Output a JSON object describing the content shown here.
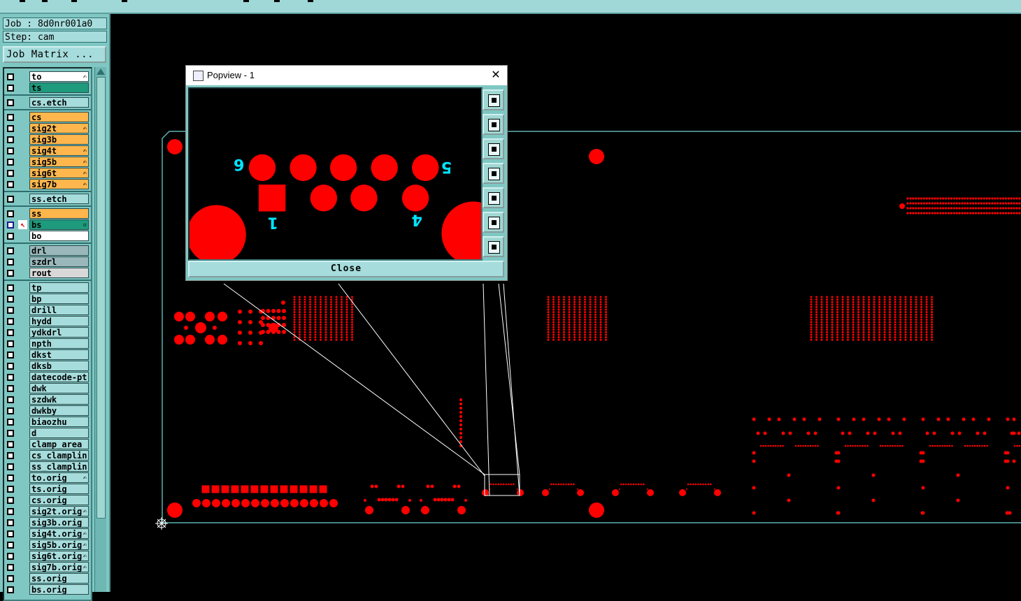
{
  "job": {
    "label": "Job : 8d0nr001a0",
    "step": "Step: cam",
    "matrix_button": "Job Matrix ..."
  },
  "colors": {
    "accent": "#7fc7c3",
    "pad": "#ff0000",
    "label_cyan": "#00e5ff",
    "outline": "#5fb0b0"
  },
  "layers": [
    {
      "name": "to",
      "color": "#ffffff",
      "hand": true
    },
    {
      "name": "ts",
      "color": "#1e9a7c",
      "hand": false
    },
    {
      "name": "cs.etch",
      "color": "#a6dcdc",
      "hand": false
    },
    {
      "name": "cs",
      "color": "#ffb74d",
      "hand": false
    },
    {
      "name": "sig2t",
      "color": "#ffb74d",
      "hand": true
    },
    {
      "name": "sig3b",
      "color": "#ffb74d",
      "hand": false
    },
    {
      "name": "sig4t",
      "color": "#ffb74d",
      "hand": true
    },
    {
      "name": "sig5b",
      "color": "#ffb74d",
      "hand": true
    },
    {
      "name": "sig6t",
      "color": "#ffb74d",
      "hand": true
    },
    {
      "name": "sig7b",
      "color": "#ffb74d",
      "hand": true
    },
    {
      "name": "ss.etch",
      "color": "#a6dcdc",
      "hand": false
    },
    {
      "name": "ss",
      "color": "#ffb74d",
      "hand": false
    },
    {
      "name": "bs",
      "color": "#1e9a7c",
      "hand": false,
      "selected": true
    },
    {
      "name": "bo",
      "color": "#ffffff",
      "hand": false
    },
    {
      "name": "drl",
      "color": "#9ab8bb",
      "hand": false
    },
    {
      "name": "szdrl",
      "color": "#9ab8bb",
      "hand": false
    },
    {
      "name": "rout",
      "color": "#d8d8d8",
      "hand": false
    },
    {
      "name": "tp",
      "color": "#a6dcdc",
      "hand": false
    },
    {
      "name": "bp",
      "color": "#a6dcdc",
      "hand": false
    },
    {
      "name": "drill",
      "color": "#a6dcdc",
      "hand": false
    },
    {
      "name": "hydd",
      "color": "#a6dcdc",
      "hand": false
    },
    {
      "name": "ydkdrl",
      "color": "#a6dcdc",
      "hand": false
    },
    {
      "name": "npth",
      "color": "#a6dcdc",
      "hand": false
    },
    {
      "name": "dkst",
      "color": "#a6dcdc",
      "hand": false
    },
    {
      "name": "dksb",
      "color": "#a6dcdc",
      "hand": false
    },
    {
      "name": "datecode-pt",
      "color": "#a6dcdc",
      "hand": false
    },
    {
      "name": "dwk",
      "color": "#a6dcdc",
      "hand": false
    },
    {
      "name": "szdwk",
      "color": "#a6dcdc",
      "hand": false
    },
    {
      "name": "dwkby",
      "color": "#a6dcdc",
      "hand": false
    },
    {
      "name": "biaozhu",
      "color": "#a6dcdc",
      "hand": false
    },
    {
      "name": "d",
      "color": "#a6dcdc",
      "hand": false
    },
    {
      "name": "clamp_area",
      "color": "#a6dcdc",
      "hand": false
    },
    {
      "name": "cs_clamplin",
      "color": "#a6dcdc",
      "hand": false
    },
    {
      "name": "ss_clamplin",
      "color": "#a6dcdc",
      "hand": false
    },
    {
      "name": "to.orig",
      "color": "#a6dcdc",
      "hand": true
    },
    {
      "name": "ts.orig",
      "color": "#a6dcdc",
      "hand": false
    },
    {
      "name": "cs.orig",
      "color": "#a6dcdc",
      "hand": false
    },
    {
      "name": "sig2t.orig",
      "color": "#a6dcdc",
      "hand": true
    },
    {
      "name": "sig3b.orig",
      "color": "#a6dcdc",
      "hand": false
    },
    {
      "name": "sig4t.orig",
      "color": "#a6dcdc",
      "hand": true
    },
    {
      "name": "sig5b.orig",
      "color": "#a6dcdc",
      "hand": true
    },
    {
      "name": "sig6t.orig",
      "color": "#a6dcdc",
      "hand": true
    },
    {
      "name": "sig7b.orig",
      "color": "#a6dcdc",
      "hand": true
    },
    {
      "name": "ss.orig",
      "color": "#a6dcdc",
      "hand": false
    },
    {
      "name": "bs.orig",
      "color": "#a6dcdc",
      "hand": false
    }
  ],
  "popview": {
    "title": "Popview - 1",
    "close_label": "Close",
    "pin_labels": [
      "6",
      "5",
      "1",
      "4"
    ]
  }
}
